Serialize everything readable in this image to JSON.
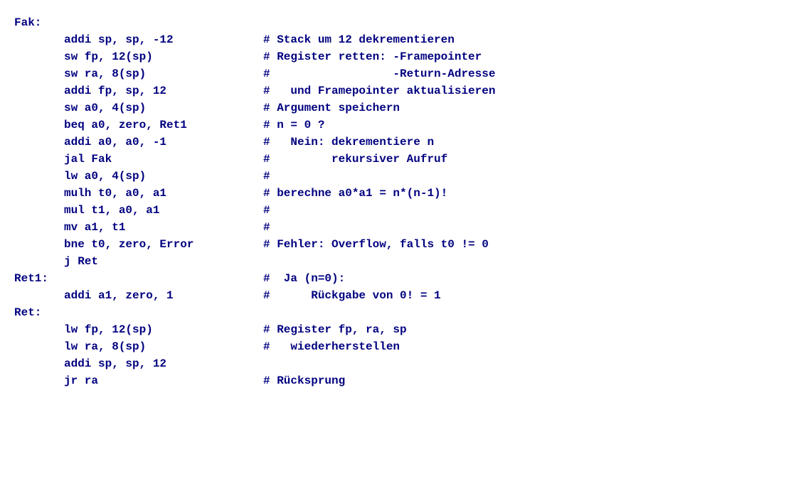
{
  "lines": [
    {
      "label": "Fak:",
      "instr": "",
      "comment": ""
    },
    {
      "label": "",
      "instr": "addi sp, sp, -12",
      "comment": "# Stack um 12 dekrementieren"
    },
    {
      "label": "",
      "instr": "sw fp, 12(sp)",
      "comment": "# Register retten: -Framepointer"
    },
    {
      "label": "",
      "instr": "sw ra, 8(sp)",
      "comment": "#                  -Return-Adresse"
    },
    {
      "label": "",
      "instr": "addi fp, sp, 12",
      "comment": "#   und Framepointer aktualisieren"
    },
    {
      "label": "",
      "instr": "sw a0, 4(sp)",
      "comment": "# Argument speichern"
    },
    {
      "label": "",
      "instr": "beq a0, zero, Ret1",
      "comment": "# n = 0 ?"
    },
    {
      "label": "",
      "instr": "addi a0, a0, -1",
      "comment": "#   Nein: dekrementiere n"
    },
    {
      "label": "",
      "instr": "jal Fak",
      "comment": "#         rekursiver Aufruf"
    },
    {
      "label": "",
      "instr": "lw a0, 4(sp)",
      "comment": "#"
    },
    {
      "label": "",
      "instr": "mulh t0, a0, a1",
      "comment": "# berechne a0*a1 = n*(n-1)!"
    },
    {
      "label": "",
      "instr": "mul t1, a0, a1",
      "comment": "#"
    },
    {
      "label": "",
      "instr": "mv a1, t1",
      "comment": "#"
    },
    {
      "label": "",
      "instr": "bne t0, zero, Error",
      "comment": "# Fehler: Overflow, falls t0 != 0"
    },
    {
      "label": "",
      "instr": "j Ret",
      "comment": ""
    },
    {
      "label": "Ret1:",
      "instr": "",
      "comment": "#  Ja (n=0):"
    },
    {
      "label": "",
      "instr": "addi a1, zero, 1",
      "comment": "#      Rückgabe von 0! = 1"
    },
    {
      "label": "Ret:",
      "instr": "",
      "comment": ""
    },
    {
      "label": "",
      "instr": "lw fp, 12(sp)",
      "comment": "# Register fp, ra, sp"
    },
    {
      "label": "",
      "instr": "lw ra, 8(sp)",
      "comment": "#   wiederherstellen"
    },
    {
      "label": "",
      "instr": "addi sp, sp, 12",
      "comment": ""
    },
    {
      "label": "",
      "instr": "jr ra",
      "comment": "# Rücksprung"
    }
  ]
}
